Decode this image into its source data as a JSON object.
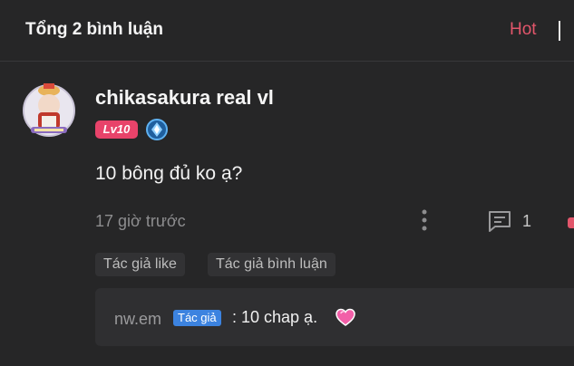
{
  "header": {
    "title": "Tổng 2 bình luận",
    "sort_label": "Hot"
  },
  "comment": {
    "username": "chikasakura real vl",
    "level": "Lv10",
    "text": "10 bông đủ ko ạ?",
    "time": "17 giờ trước",
    "reply_count": "1",
    "tags": [
      "Tác giả like",
      "Tác giả bình luận"
    ]
  },
  "reply": {
    "name": "nw.em",
    "badge": "Tác giả",
    "text": ": 10 chap ạ."
  },
  "colors": {
    "accent": "#e2566b",
    "level_badge": "#e8436a",
    "author_badge": "#3c83e0",
    "background": "#262627"
  },
  "icons": [
    "avatar",
    "rank-diamond-icon",
    "more-vertical-icon",
    "comment-icon",
    "heart-emoji-icon"
  ]
}
